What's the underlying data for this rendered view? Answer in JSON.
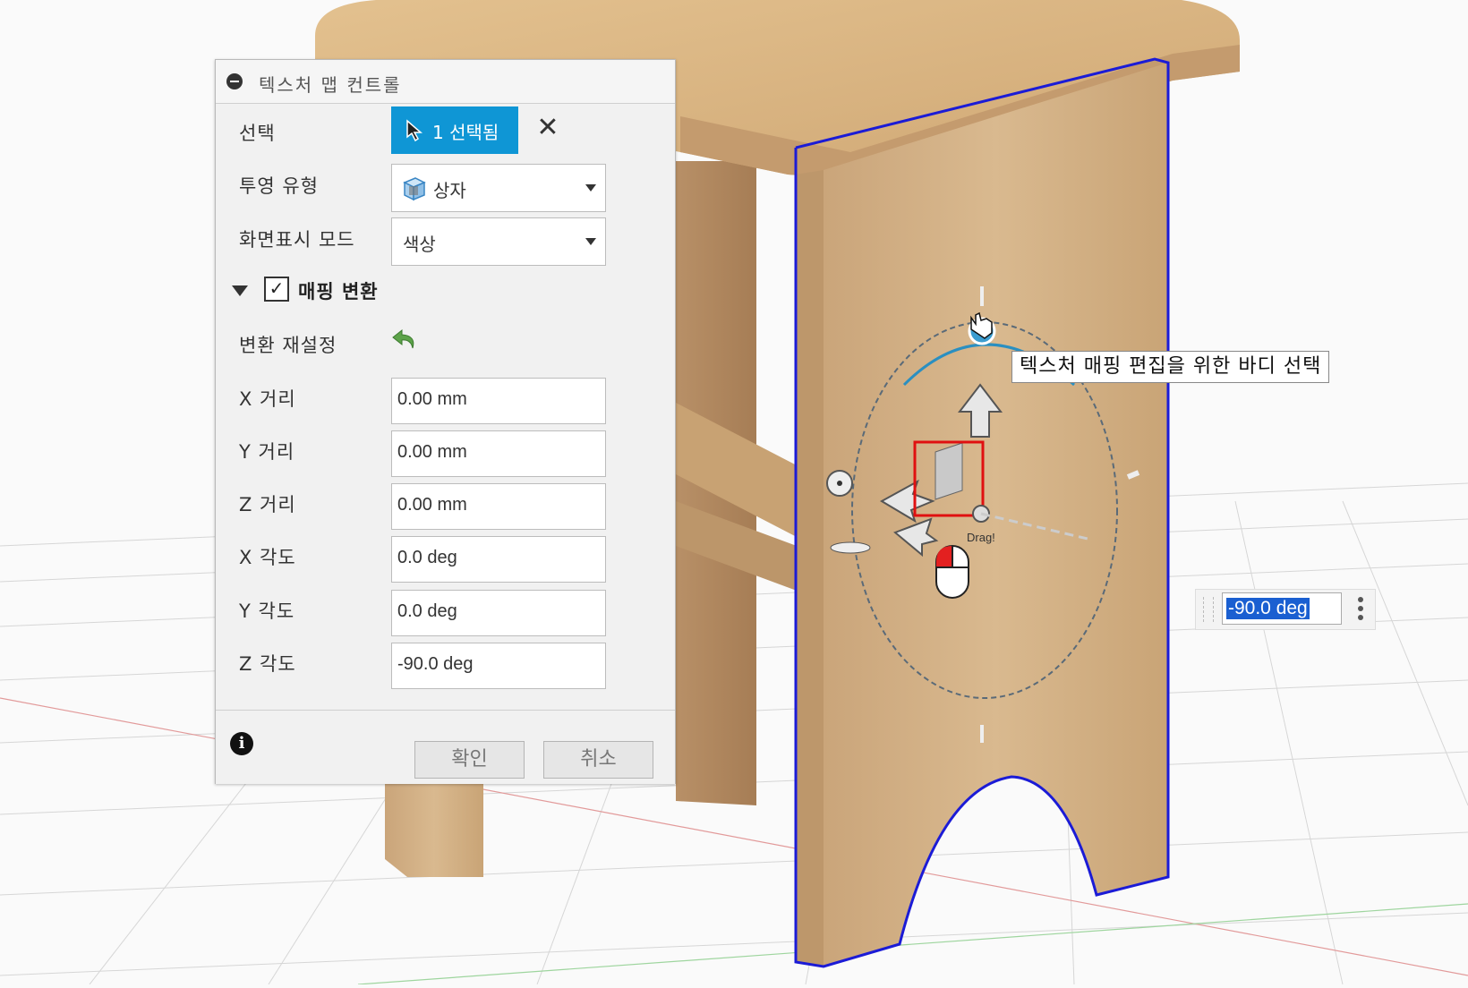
{
  "panel": {
    "title": "텍스처 맵 컨트롤",
    "selection": {
      "label": "선택",
      "button": "1 선택됨"
    },
    "projection": {
      "label": "투영 유형",
      "value": "상자"
    },
    "display_mode": {
      "label": "화면표시 모드",
      "value": "색상"
    },
    "mapping": {
      "label": "매핑 변환",
      "checked": true
    },
    "reset": {
      "label": "변환 재설정"
    },
    "fields": [
      {
        "label": "X 거리",
        "value": "0.00 mm"
      },
      {
        "label": "Y 거리",
        "value": "0.00 mm"
      },
      {
        "label": "Z 거리",
        "value": "0.00 mm"
      },
      {
        "label": "X 각도",
        "value": "0.0 deg"
      },
      {
        "label": "Y 각도",
        "value": "0.0 deg"
      },
      {
        "label": "Z 각도",
        "value": "-90.0 deg"
      }
    ],
    "ok": "확인",
    "cancel": "취소"
  },
  "viewport": {
    "tooltip": "텍스처 매핑 편집을 위한 바디 선택",
    "angle_input": "-90.0 deg",
    "drag_hint": "Drag!"
  },
  "colors": {
    "accent": "#0f96d5",
    "wood": "#d8b78a",
    "selection_edge": "#1b1bd6",
    "highlight_box": "#e01010"
  },
  "icons": [
    "cursor-arrow-icon",
    "box-projection-icon",
    "undo-arrow-icon",
    "info-icon",
    "hand-cursor-icon",
    "mouse-icon",
    "more-vertical-icon"
  ]
}
